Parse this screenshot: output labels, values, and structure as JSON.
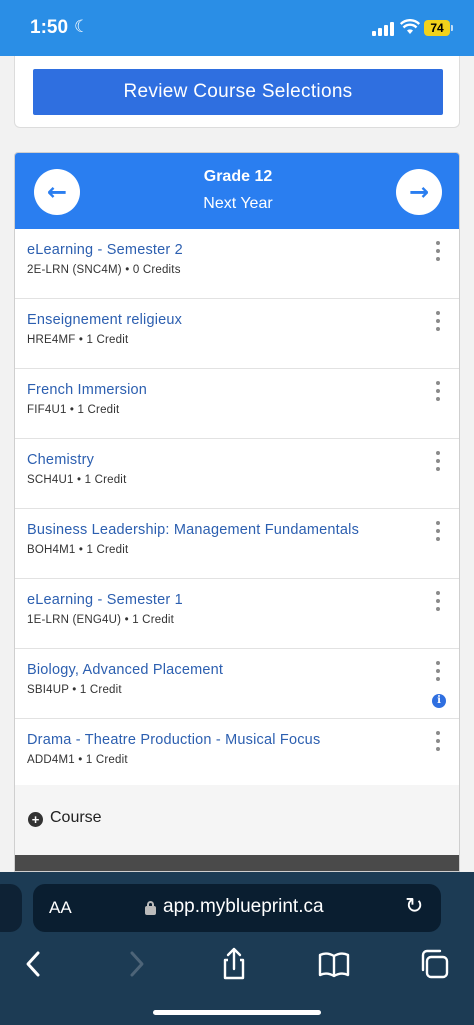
{
  "status_bar": {
    "time": "1:50",
    "battery": "74"
  },
  "review": {
    "button_label": "Review Course Selections"
  },
  "year_nav": {
    "grade": "Grade 12",
    "year": "Next Year",
    "prev_icon": "arrow-left-icon",
    "next_icon": "arrow-right-icon"
  },
  "courses": [
    {
      "name": "eLearning - Semester 2",
      "meta": "2E-LRN (SNC4M) • 0 Credits"
    },
    {
      "name": "Enseignement religieux",
      "meta": "HRE4MF • 1 Credit"
    },
    {
      "name": "French Immersion",
      "meta": "FIF4U1 • 1 Credit"
    },
    {
      "name": "Chemistry",
      "meta": "SCH4U1 • 1 Credit"
    },
    {
      "name": "Business Leadership: Management Fundamentals",
      "meta": "BOH4M1 • 1 Credit"
    },
    {
      "name": "eLearning - Semester 1",
      "meta": "1E-LRN (ENG4U) • 1 Credit"
    },
    {
      "name": "Biology, Advanced Placement",
      "meta": "SBI4UP • 1 Credit",
      "has_info": true
    },
    {
      "name": "Drama - Theatre Production - Musical Focus",
      "meta": "ADD4M1 • 1 Credit"
    }
  ],
  "add_course": {
    "label": "Course"
  },
  "browser": {
    "aa_label": "AA",
    "url": "app.myblueprint.ca"
  },
  "colors": {
    "status_bar": "#2a8ee6",
    "primary_button": "#2f6fe0",
    "header": "#2a7ef0",
    "course_link": "#2c5fb0",
    "browser_chrome": "#1c3b54"
  }
}
